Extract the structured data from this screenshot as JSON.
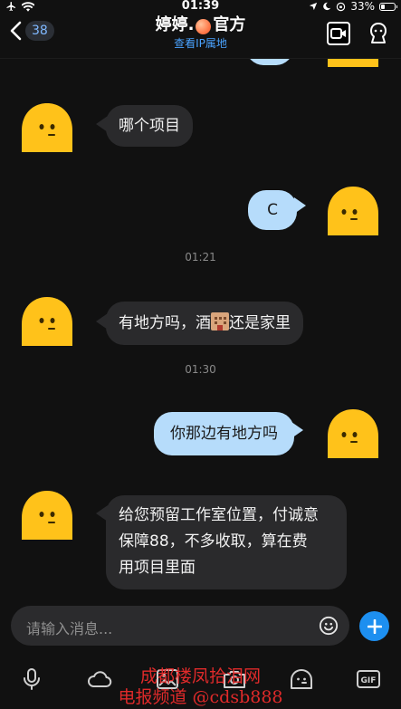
{
  "status_bar": {
    "time": "01:39",
    "battery": "33%",
    "battery_level": 0.33
  },
  "header": {
    "unread_count": "38",
    "title_prefix": "婷婷.",
    "title_suffix": "官方",
    "subtitle": "查看IP属地"
  },
  "messages": [
    {
      "direction": "in",
      "text": "哪个项目"
    },
    {
      "direction": "out",
      "text": "C"
    },
    {
      "type": "time",
      "text": "01:21"
    },
    {
      "direction": "in",
      "text_before": "有地方吗，酒",
      "text_after": "还是家里"
    },
    {
      "type": "time",
      "text": "01:30"
    },
    {
      "direction": "out",
      "text": "你那边有地方吗"
    },
    {
      "direction": "in",
      "lines": [
        "给您预留工作室位置，付诚意",
        "保障88，不多收取，算在费",
        "用项目里面"
      ]
    }
  ],
  "input": {
    "placeholder": "请输入消息..."
  },
  "toolbar": {
    "items": [
      "mic-icon",
      "cloud-icon",
      "image-icon",
      "camera-icon",
      "emoji-icon",
      "gif-icon"
    ],
    "gif_label": "GIF"
  },
  "watermark": {
    "line1": "成都楼凤拾泪网",
    "line2": "电报频道 @cdsb888"
  },
  "colors": {
    "background": "#111111",
    "bubble_in": "#2a2a2c",
    "bubble_out": "#b6dcfb",
    "accent": "#1d8ff0",
    "link": "#4aa3ff",
    "avatar": "#ffc21a",
    "watermark": "#e02a2a"
  }
}
